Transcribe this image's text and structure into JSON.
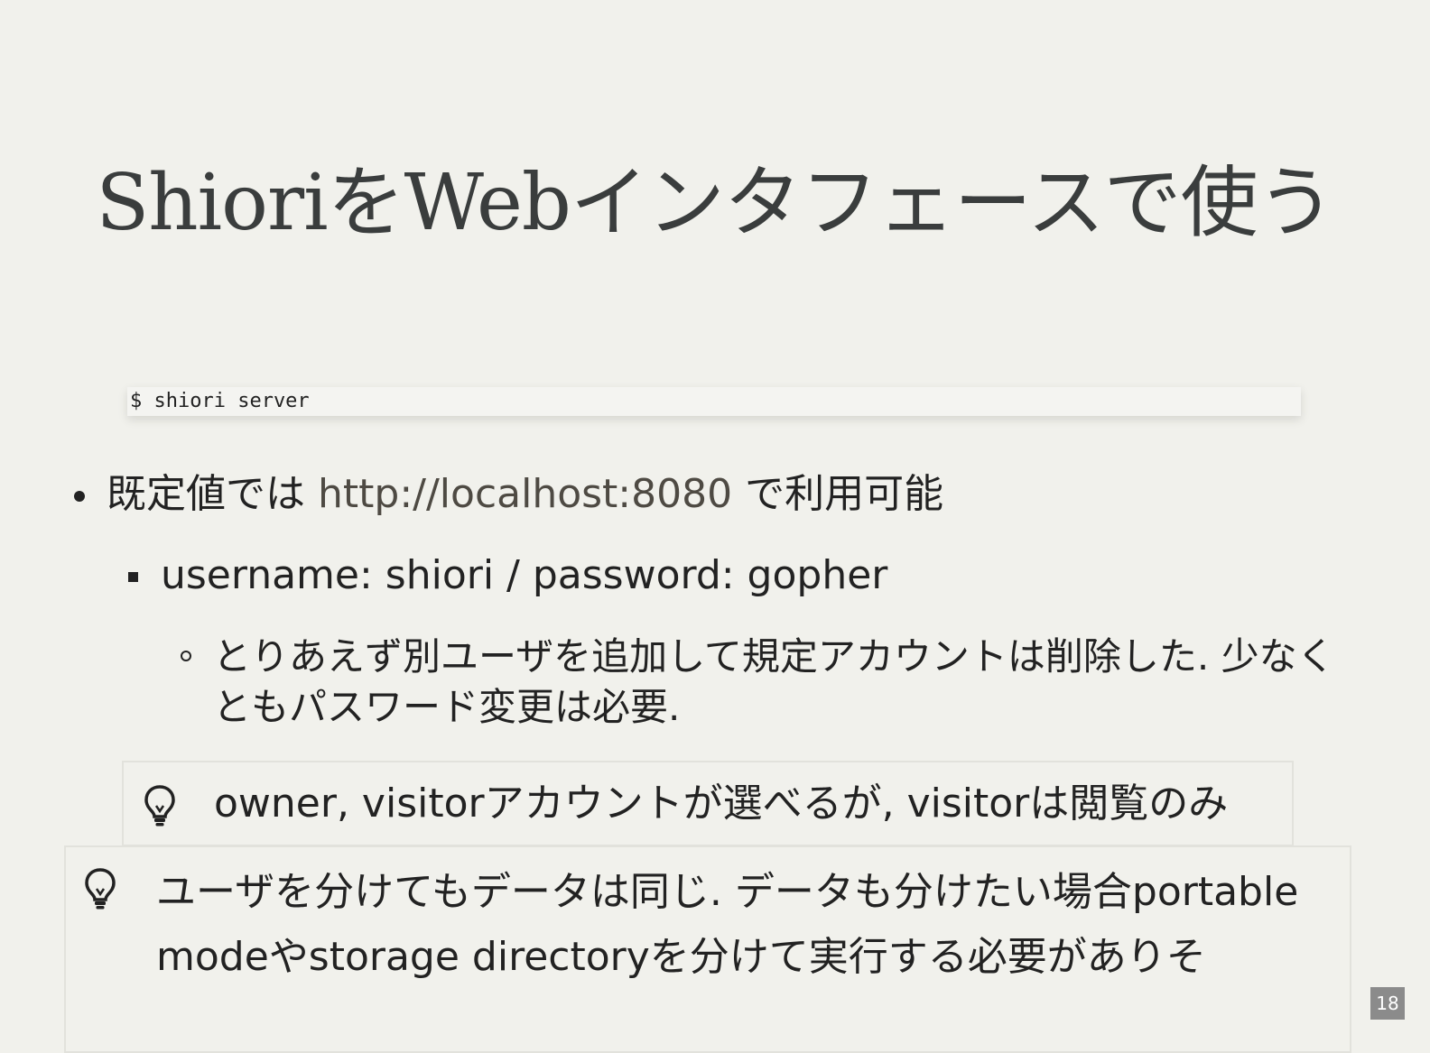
{
  "slide": {
    "title": "ShioriをWebインタフェースで使う",
    "code": "$ shiori server",
    "bullet_l1": {
      "prefix": "既定値では ",
      "link": "http://localhost:8080",
      "suffix": " で利用可能"
    },
    "bullet_l2": "username: shiori / password: gopher",
    "bullet_l3": "とりあえず別ユーザを追加して規定アカウントは削除した. 少なくともパスワード変更は必要.",
    "tip_1": "owner, visitorアカウントが選べるが, visitorは閲覧のみ",
    "tip_2": "ユーザを分けてもデータは同じ. データも分けたい場合portable modeやstorage directoryを分けて実行する必要がありそ",
    "page_number": "18"
  },
  "icons": {
    "tip_icon": "lightbulb-icon"
  }
}
